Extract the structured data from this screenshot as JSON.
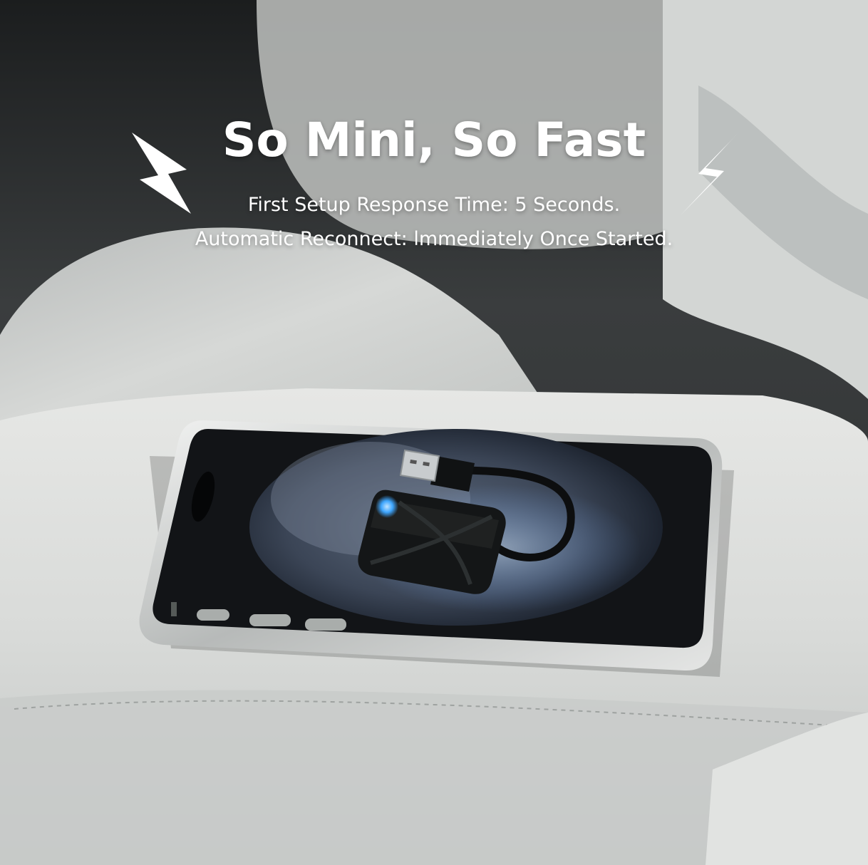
{
  "headline": {
    "title": "So Mini, So Fast",
    "line1": "First Setup Response Time: 5 Seconds.",
    "line2": "Automatic Reconnect: lmmediately Once Started."
  },
  "icons": {
    "left": "lightning-bolt-icon",
    "right": "lightning-bolt-icon"
  },
  "colors": {
    "headline_text": "#ffffff",
    "seat_leather": "#d9dbd9",
    "cabin_dark": "#1e2021",
    "phone_frame": "#c8cac8",
    "adapter_body": "#141617",
    "adapter_led": "#3ea6ff"
  }
}
